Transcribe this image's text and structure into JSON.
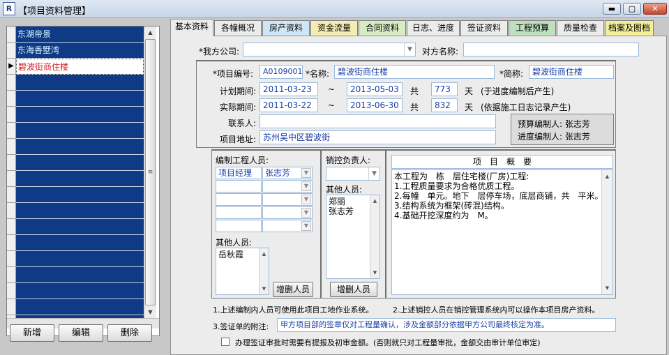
{
  "window": {
    "icon_text": "R",
    "title": "【项目资料管理】",
    "buttons": {
      "minimize": "▬",
      "maximize": "▢",
      "close": "✕"
    }
  },
  "left_panel": {
    "projects": [
      "东湖帝景",
      "东海香墅湾",
      "碧波街商住楼"
    ],
    "selected_index": 2,
    "selected_marker": "▶",
    "buttons": {
      "add": "新增",
      "edit": "编辑",
      "delete": "删除"
    }
  },
  "tabs": [
    "基本资料",
    "各幢概况",
    "房产资料",
    "资金流量",
    "合同资料",
    "日志、进度",
    "签证资料",
    "工程预算",
    "质量检查",
    "档案及图档"
  ],
  "active_tab": 0,
  "tab_colors": {
    "default": "#ececec",
    "房产资料": "#cfe6f7",
    "资金流量": "#f4ecb3",
    "合同资料": "#d7ecc3",
    "日志、进度": "#ececec",
    "签证资料": "#ececec",
    "工程预算": "#bfe0bf",
    "质量检查": "#ececec",
    "档案及图档": "#f5ef97"
  },
  "basic": {
    "our_company_label": "*我方公司:",
    "our_company_value": "",
    "other_party_label": "对方名称:",
    "other_party_value": "",
    "project_no_label": "*项目编号:",
    "project_no": "A0109001",
    "name_label": "*名称:",
    "name": "碧波街商住楼",
    "short_label": "*简称:",
    "short_name": "碧波街商住楼",
    "plan_label": "计划期间:",
    "plan_start": "2011-03-23",
    "tilde": "~",
    "plan_end": "2013-05-03",
    "total_label": "共",
    "plan_days": "773",
    "days_label": "天",
    "plan_note": "(于进度编制后产生)",
    "actual_label": "实际期间:",
    "actual_start": "2011-03-22",
    "actual_end": "2013-06-30",
    "actual_days": "832",
    "actual_note": "(依据施工日志记录产生)",
    "contact_label": "联系人:",
    "contact_value": "",
    "address_label": "项目地址:",
    "address": "苏州吴中区碧波街",
    "budget_editor": "预算编制人: 张志芳",
    "progress_editor": "进度编制人: 张志芳"
  },
  "staff": {
    "eng_label": "编制工程人员:",
    "grid_rows": [
      [
        "项目经理",
        "张志芳"
      ],
      [
        "",
        ""
      ],
      [
        "",
        ""
      ],
      [
        "",
        ""
      ],
      [
        "",
        ""
      ]
    ],
    "other_label": "其他人员:",
    "other_people": [
      "岳秋霞"
    ],
    "add_remove": "增删人员"
  },
  "sales": {
    "label": "销控负责人:",
    "value": "",
    "other_label": "其他人员:",
    "other_people": [
      "郑丽",
      "张志芳"
    ],
    "add_remove": "增删人员"
  },
  "overview": {
    "header": "项　目　概　要",
    "lines": [
      "本工程为　栋　层住宅楼(厂房)工程:",
      "1.工程质量要求为合格优质工程。",
      "2.每幢　单元。地下　层停车场，底层商铺，共　平米。",
      "3.结构系统为框架(砖混)结构。",
      "4.基础开挖深度约为　M。"
    ]
  },
  "notes": {
    "note1": "1.上述编制内人员可使用此项目工地作业系统。",
    "note2": "2.上述销控人员在销控管理系统内可以操作本项目房产资料。",
    "note3_label": "3.签证单的附注:",
    "note3_value": "甲方项目部的签章仅对工程量确认，涉及金额部分依据甲方公司最终核定为准。",
    "checkbox_label": "办理签证审批时需要有提报及初审金额。(否则就只对工程量审批，金额交由审计单位审定)"
  }
}
